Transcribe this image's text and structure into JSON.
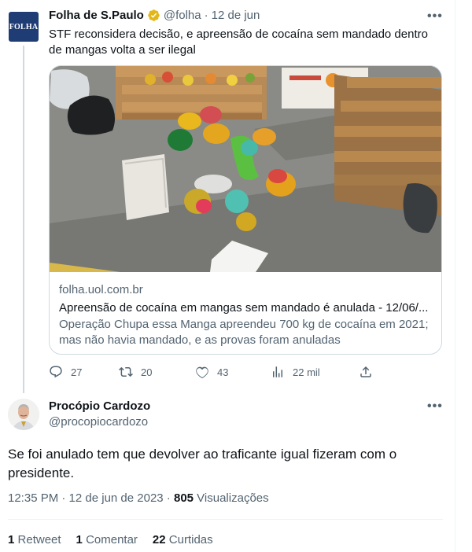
{
  "parent_tweet": {
    "avatar_text": "FOLHA",
    "author_name": "Folha de S.Paulo",
    "handle": "@folha",
    "separator": "·",
    "date": "12 de jun",
    "more_icon": "•••",
    "text": "STF reconsidera decisão, e apreensão de cocaína sem mandado dentro de mangas volta a ser ilegal",
    "card": {
      "image": "photo-of-seized-mangoes-with-cocaine",
      "domain": "folha.uol.com.br",
      "title": "Apreensão de cocaína em mangas sem mandado é anulada - 12/06/...",
      "description": "Operação Chupa essa Manga apreendeu 700 kg de cocaína em 2021; mas não havia mandado, e as provas foram anuladas"
    },
    "actions": {
      "replies": "27",
      "retweets": "20",
      "likes": "43",
      "views": "22 mil"
    }
  },
  "reply_tweet": {
    "author_name": "Procópio Cardozo",
    "handle": "@procopiocardozo",
    "more_icon": "•••",
    "text": "Se foi anulado tem que devolver ao traficante igual fizeram com o presidente.",
    "timestamp": "12:35 PM · 12 de jun de 2023 · ",
    "view_count": "805",
    "views_label": " Visualizações",
    "stats": {
      "retweets_count": "1",
      "retweets_label": "Retweet",
      "comments_count": "1",
      "comments_label": "Comentar",
      "likes_count": "22",
      "likes_label": "Curtidas"
    }
  },
  "colors": {
    "text": "#0f1419",
    "muted": "#536471",
    "border": "#cfd9de",
    "verified": "#e2b719",
    "folha_blue": "#1f3c74"
  }
}
